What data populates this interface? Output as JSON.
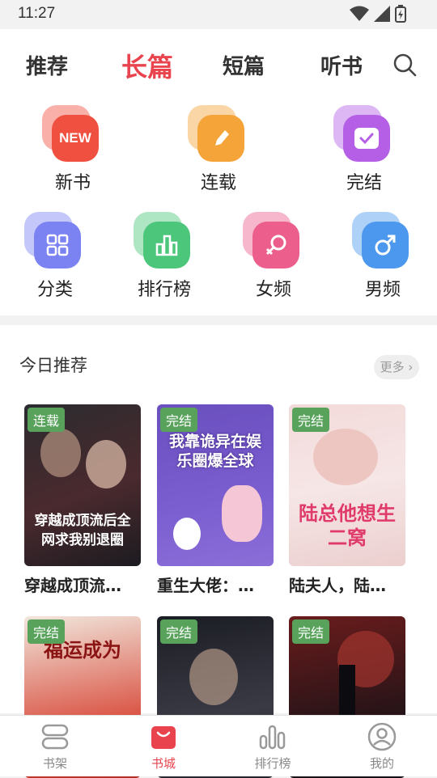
{
  "status": {
    "time": "11:27"
  },
  "tabs": [
    {
      "label": "推荐"
    },
    {
      "label": "长篇"
    },
    {
      "label": "短篇"
    },
    {
      "label": "听书"
    }
  ],
  "categories": [
    {
      "label": "新书",
      "icon": "new-icon",
      "color": "#f0503f"
    },
    {
      "label": "连载",
      "icon": "pencil-icon",
      "color": "#f5a43a"
    },
    {
      "label": "完结",
      "icon": "check-icon",
      "color": "#b45fe6"
    },
    {
      "label": "分类",
      "icon": "grid-icon",
      "color": "#7b82f2"
    },
    {
      "label": "排行榜",
      "icon": "bar-chart-icon",
      "color": "#4cc67a"
    },
    {
      "label": "女频",
      "icon": "female-icon",
      "color": "#ec5f8d"
    },
    {
      "label": "男频",
      "icon": "male-icon",
      "color": "#4c98ee"
    }
  ],
  "new_badge": "NEW",
  "section": {
    "title": "今日推荐",
    "more": "更多"
  },
  "books": [
    {
      "badge": "连载",
      "name": "穿越成顶流…",
      "cover_text": "穿越成顶流后全网求我别退圈"
    },
    {
      "badge": "完结",
      "name": "重生大佬：…",
      "cover_text": "我靠诡异在娱乐圈爆全球"
    },
    {
      "badge": "完结",
      "name": "陆夫人，陆…",
      "cover_text": "陆总他想生二窝"
    },
    {
      "badge": "完结",
      "name": "",
      "cover_text": "福运成为"
    },
    {
      "badge": "完结",
      "name": "",
      "cover_text": ""
    },
    {
      "badge": "完结",
      "name": "",
      "cover_text": ""
    }
  ],
  "nav": [
    {
      "label": "书架",
      "icon": "bookshelf-icon"
    },
    {
      "label": "书城",
      "icon": "bookstore-icon"
    },
    {
      "label": "排行榜",
      "icon": "ranking-icon"
    },
    {
      "label": "我的",
      "icon": "profile-icon"
    }
  ]
}
